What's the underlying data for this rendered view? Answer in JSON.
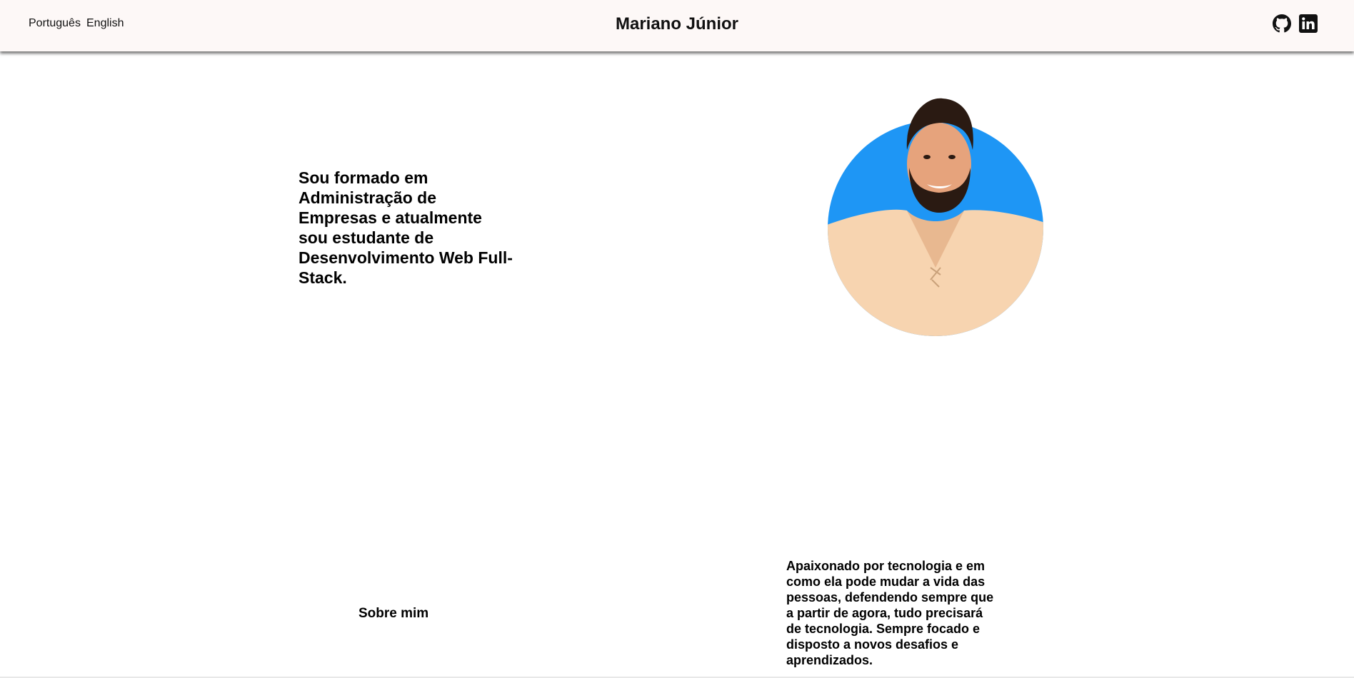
{
  "header": {
    "languages": [
      "Português",
      "English"
    ],
    "brand": "Mariano Júnior",
    "social": [
      {
        "icon": "github-icon"
      },
      {
        "icon": "linkedin-icon"
      }
    ]
  },
  "hero": {
    "text": "Sou formado em Administração de Empresas e atualmente sou estudante de Desenvolvimento Web Full-Stack.",
    "avatar_bg_color": "#1e96f5"
  },
  "about": {
    "label": "Sobre mim",
    "text": "Apaixonado por tecnologia e em como ela pode mudar a vida das pessoas, defendendo sempre que a partir de agora, tudo precisará de tecnologia. Sempre focado e disposto a novos desafios e aprendizados."
  }
}
